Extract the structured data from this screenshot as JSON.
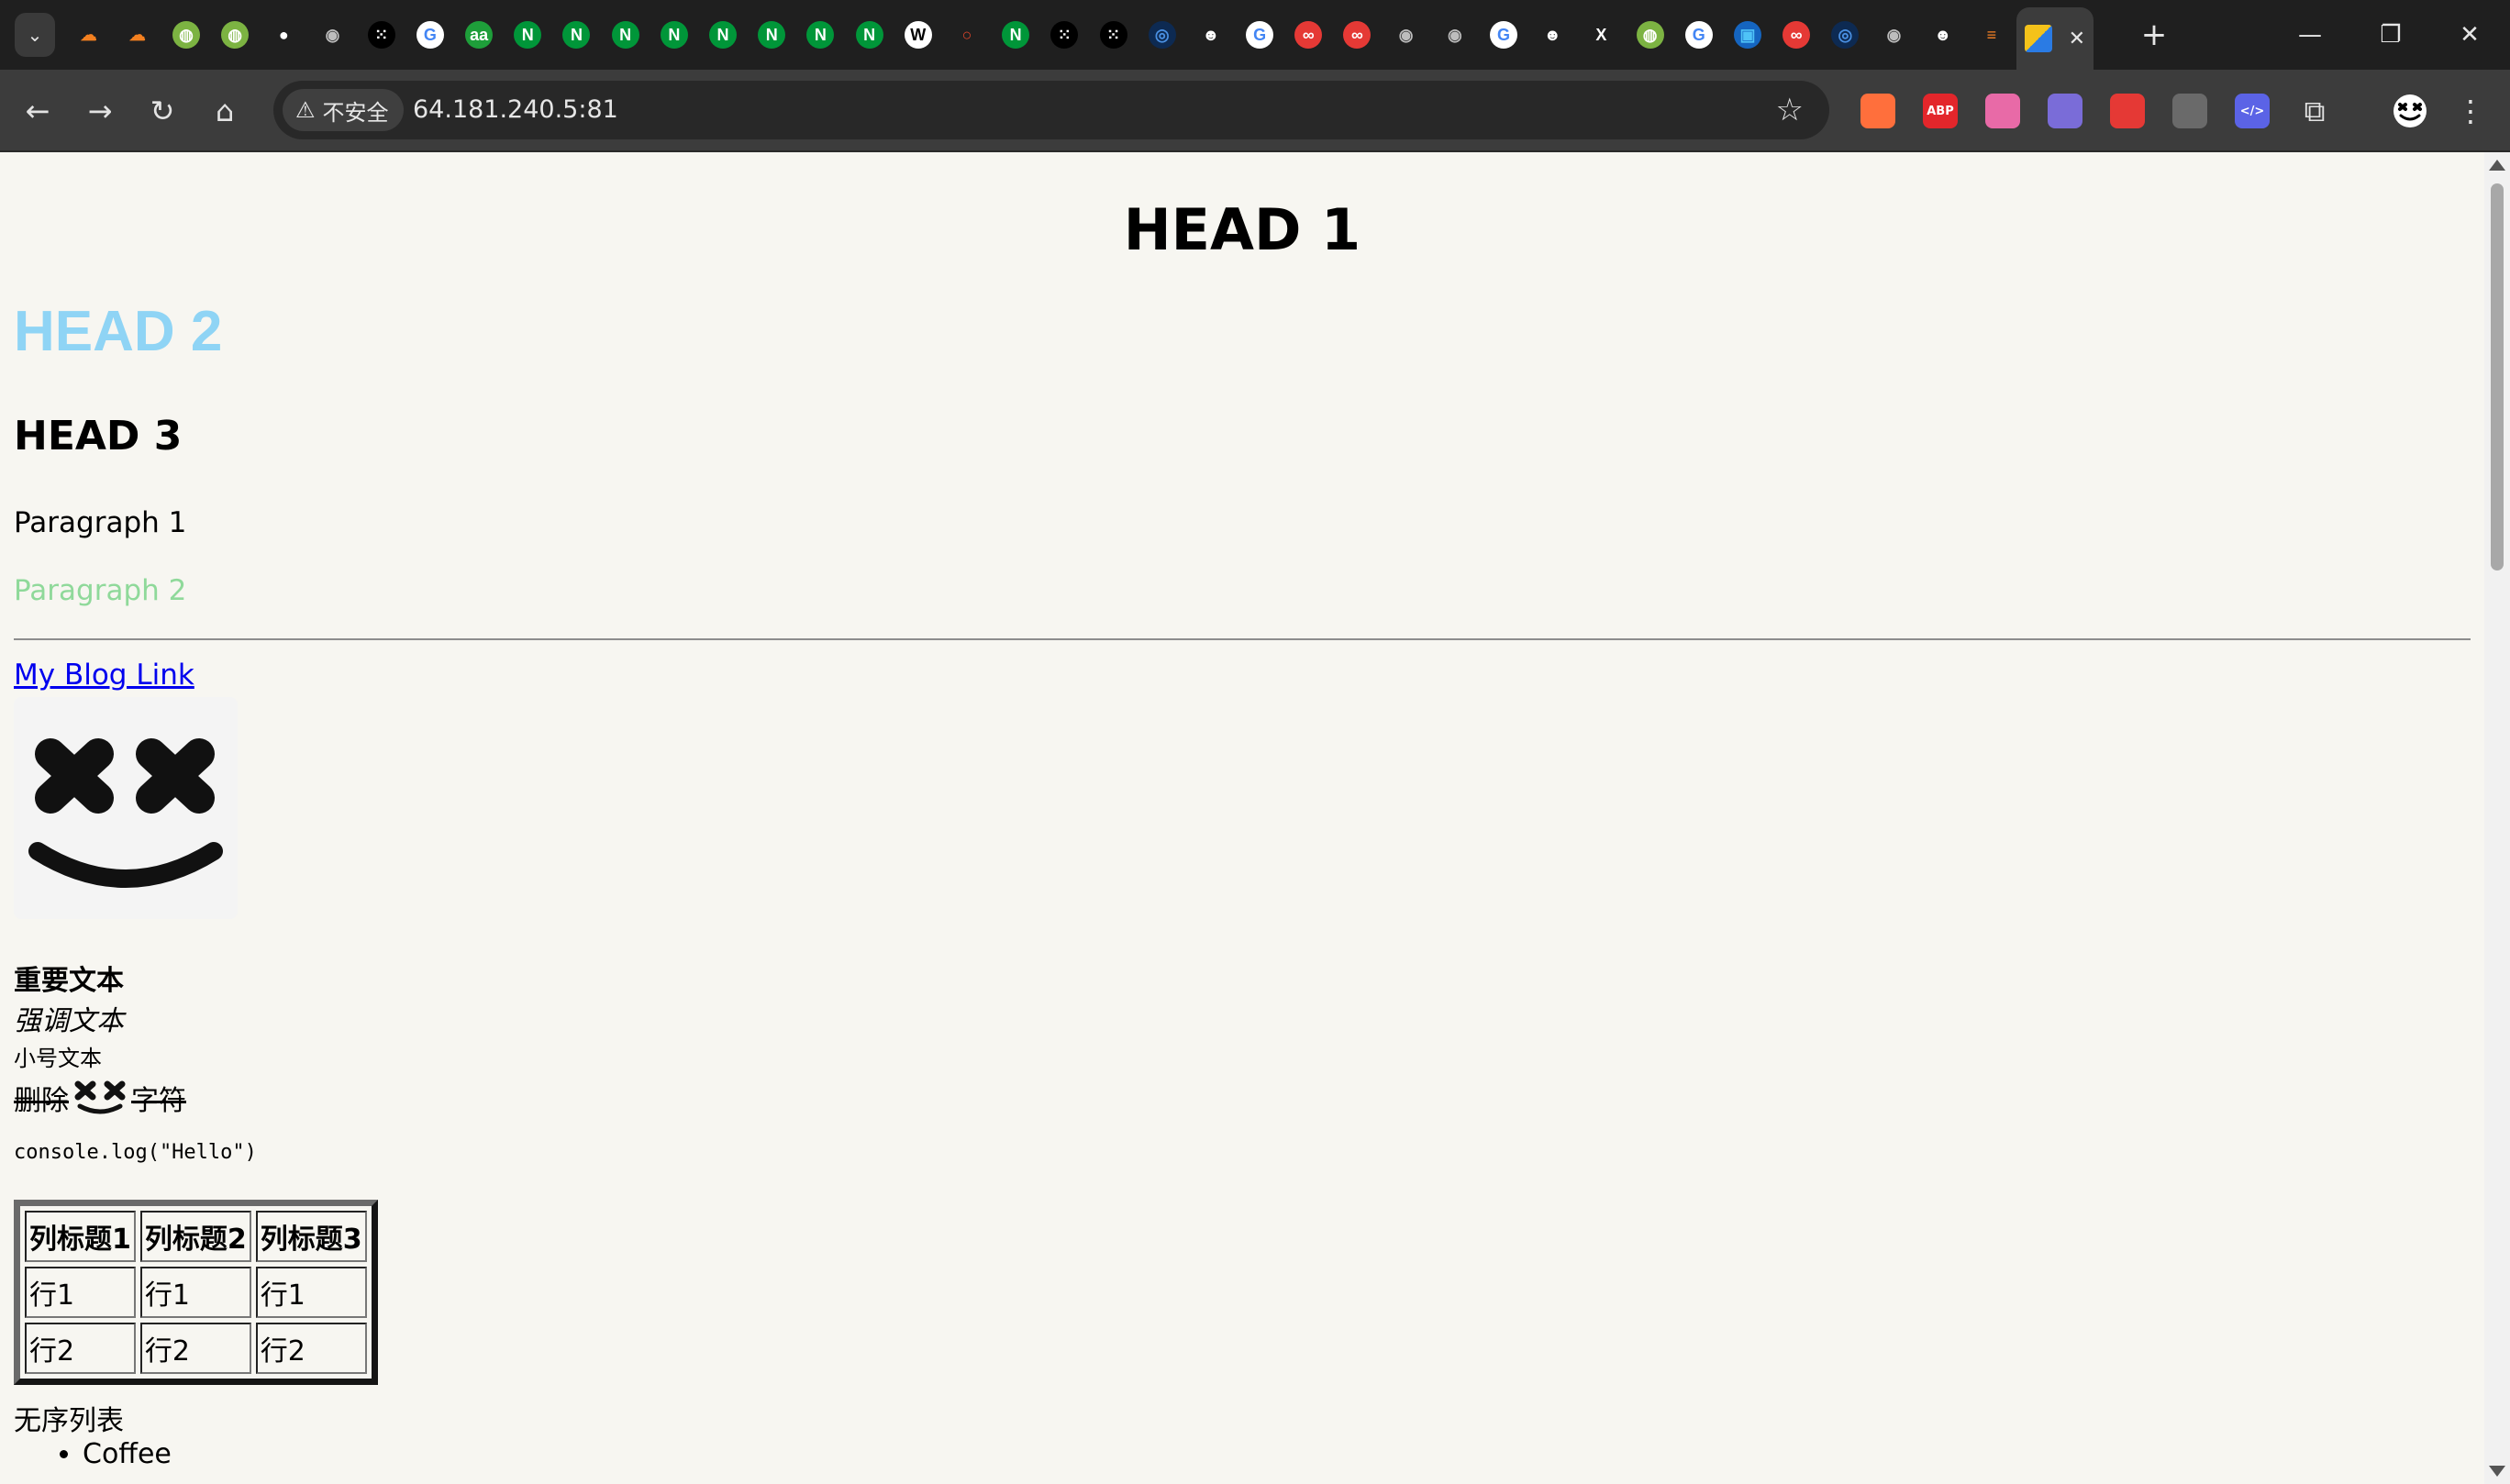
{
  "browser": {
    "pinned_tabs": [
      {
        "icon": "cloudflare-icon",
        "glyph": "☁",
        "color": "#f38020",
        "bg": "transparent"
      },
      {
        "icon": "cloudflare-icon",
        "glyph": "☁",
        "color": "#f38020",
        "bg": "transparent"
      },
      {
        "icon": "speedtest-icon",
        "glyph": "◍",
        "color": "#ffffff",
        "bg": "#7cb342"
      },
      {
        "icon": "speedtest-icon",
        "glyph": "◍",
        "color": "#ffffff",
        "bg": "#7cb342"
      },
      {
        "icon": "github-icon",
        "glyph": "●",
        "color": "#ffffff",
        "bg": "transparent"
      },
      {
        "icon": "globe-icon",
        "glyph": "◉",
        "color": "#bdbdbd",
        "bg": "transparent"
      },
      {
        "icon": "dice-icon",
        "glyph": "⁙",
        "color": "#ffffff",
        "bg": "#000000"
      },
      {
        "icon": "google-icon",
        "glyph": "G",
        "color": "#4285f4",
        "bg": "#ffffff"
      },
      {
        "icon": "aa-icon",
        "glyph": "aa",
        "color": "#ffffff",
        "bg": "#1e9e3a"
      },
      {
        "icon": "nginx-icon",
        "glyph": "N",
        "color": "#ffffff",
        "bg": "#009639"
      },
      {
        "icon": "nginx-icon",
        "glyph": "N",
        "color": "#ffffff",
        "bg": "#009639"
      },
      {
        "icon": "nginx-icon",
        "glyph": "N",
        "color": "#ffffff",
        "bg": "#009639"
      },
      {
        "icon": "nginx-icon",
        "glyph": "N",
        "color": "#ffffff",
        "bg": "#009639"
      },
      {
        "icon": "nginx-icon",
        "glyph": "N",
        "color": "#ffffff",
        "bg": "#009639"
      },
      {
        "icon": "nginx-icon",
        "glyph": "N",
        "color": "#ffffff",
        "bg": "#009639"
      },
      {
        "icon": "nginx-icon",
        "glyph": "N",
        "color": "#ffffff",
        "bg": "#009639"
      },
      {
        "icon": "nginx-icon",
        "glyph": "N",
        "color": "#ffffff",
        "bg": "#009639"
      },
      {
        "icon": "wikipedia-icon",
        "glyph": "W",
        "color": "#000000",
        "bg": "#ffffff"
      },
      {
        "icon": "oracle-icon",
        "glyph": "○",
        "color": "#e0462b",
        "bg": "transparent"
      },
      {
        "icon": "nginx-icon",
        "glyph": "N",
        "color": "#ffffff",
        "bg": "#009639"
      },
      {
        "icon": "dice-icon",
        "glyph": "⁙",
        "color": "#ffffff",
        "bg": "#000000"
      },
      {
        "icon": "dice-icon",
        "glyph": "⁙",
        "color": "#ffffff",
        "bg": "#000000"
      },
      {
        "icon": "fingerprint-icon",
        "glyph": "◎",
        "color": "#4a90e2",
        "bg": "#0d2a52"
      },
      {
        "icon": "marshmello-icon",
        "glyph": "☻",
        "color": "#ffffff",
        "bg": "transparent"
      },
      {
        "icon": "google-icon",
        "glyph": "G",
        "color": "#4285f4",
        "bg": "#ffffff"
      },
      {
        "icon": "infinity-icon",
        "glyph": "∞",
        "color": "#ffffff",
        "bg": "#e53935"
      },
      {
        "icon": "infinity-icon",
        "glyph": "∞",
        "color": "#ffffff",
        "bg": "#e53935"
      },
      {
        "icon": "globe-icon",
        "glyph": "◉",
        "color": "#bdbdbd",
        "bg": "transparent"
      },
      {
        "icon": "globe-icon",
        "glyph": "◉",
        "color": "#bdbdbd",
        "bg": "transparent"
      },
      {
        "icon": "google-icon",
        "glyph": "G",
        "color": "#4285f4",
        "bg": "#ffffff"
      },
      {
        "icon": "marshmello-icon",
        "glyph": "☻",
        "color": "#ffffff",
        "bg": "transparent"
      },
      {
        "icon": "x-icon",
        "glyph": "X",
        "color": "#ffffff",
        "bg": "transparent"
      },
      {
        "icon": "speedtest-icon",
        "glyph": "◍",
        "color": "#ffffff",
        "bg": "#7cb342"
      },
      {
        "icon": "google-icon",
        "glyph": "G",
        "color": "#4285f4",
        "bg": "#ffffff"
      },
      {
        "icon": "photos-icon",
        "glyph": "▣",
        "color": "#4fc3f7",
        "bg": "#1565c0"
      },
      {
        "icon": "infinity-icon",
        "glyph": "∞",
        "color": "#ffffff",
        "bg": "#e53935"
      },
      {
        "icon": "fingerprint-icon",
        "glyph": "◎",
        "color": "#4a90e2",
        "bg": "#0d2a52"
      },
      {
        "icon": "globe-icon",
        "glyph": "◉",
        "color": "#bdbdbd",
        "bg": "transparent"
      },
      {
        "icon": "marshmello-icon",
        "glyph": "☻",
        "color": "#ffffff",
        "bg": "transparent"
      },
      {
        "icon": "stackoverflow-icon",
        "glyph": "≡",
        "color": "#f48024",
        "bg": "transparent"
      }
    ],
    "active_tab_close": "✕",
    "new_tab": "+",
    "window_minimize": "—",
    "window_restore": "❐",
    "window_close": "✕",
    "security_label": "不安全",
    "url": "64.181.240.5:81",
    "extensions": [
      {
        "icon": "bookmark-ext-icon",
        "text": "",
        "bg": "#ff6f3c"
      },
      {
        "icon": "adblock-plus-icon",
        "text": "ABP",
        "bg": "#e3262b"
      },
      {
        "icon": "cat-ext-icon",
        "text": "",
        "bg": "#e86aa7"
      },
      {
        "icon": "puzzle-color-ext-icon",
        "text": "",
        "bg": "#7a6cd8"
      },
      {
        "icon": "red-ext-icon",
        "text": "",
        "bg": "#e53935"
      },
      {
        "icon": "copy-ext-icon",
        "text": "",
        "bg": "#6a6a6a"
      },
      {
        "icon": "code-ext-icon",
        "text": "</>",
        "bg": "#5b63e6"
      }
    ]
  },
  "page": {
    "h1": "HEAD 1",
    "h2": "HEAD 2",
    "h3": "HEAD 3",
    "p1": "Paragraph 1",
    "p2": "Paragraph 2",
    "link_text": "My Blog Link",
    "strong_text": "重要文本",
    "em_text": "强调文本",
    "small_text": "小号文本",
    "del_before": "删除",
    "del_after": "字符",
    "code_text": "console.log(\"Hello\")",
    "table": {
      "headers": [
        "列标题1",
        "列标题2",
        "列标题3"
      ],
      "rows": [
        [
          "行1",
          "行1",
          "行1"
        ],
        [
          "行2",
          "行2",
          "行2"
        ]
      ]
    },
    "list_caption": "无序列表",
    "list_items": [
      "Coffee"
    ]
  }
}
